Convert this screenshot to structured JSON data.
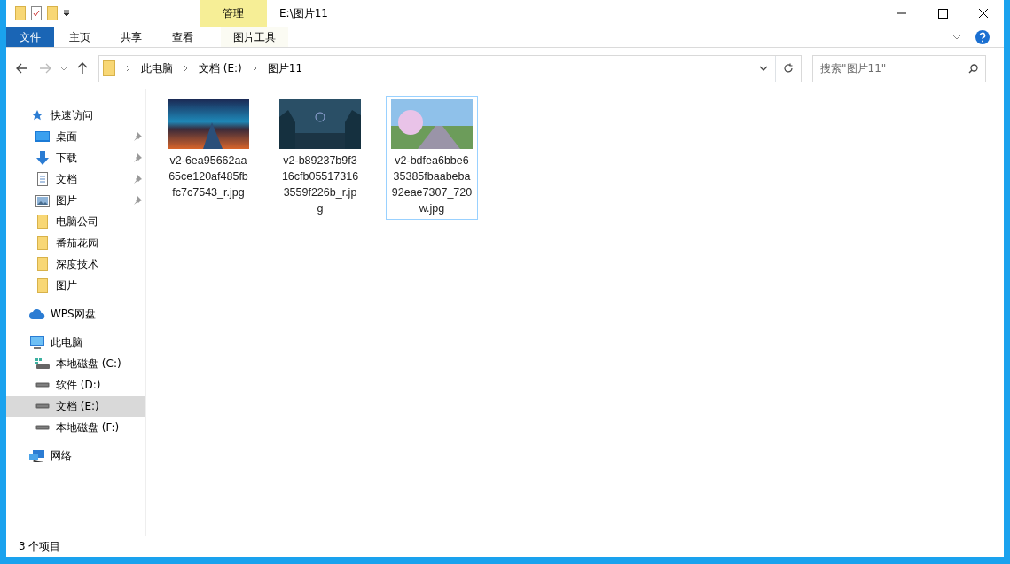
{
  "window": {
    "title": "E:\\图片11"
  },
  "context_tab": {
    "group": "管理",
    "label": "图片工具"
  },
  "ribbon_tabs": [
    {
      "label": "文件",
      "kind": "file"
    },
    {
      "label": "主页",
      "kind": "tab"
    },
    {
      "label": "共享",
      "kind": "tab"
    },
    {
      "label": "查看",
      "kind": "tab"
    }
  ],
  "breadcrumb": [
    "此电脑",
    "文档 (E:)",
    "图片11"
  ],
  "search": {
    "placeholder": "搜索\"图片11\""
  },
  "sidebar": {
    "items": [
      {
        "label": "快速访问",
        "kind": "quick",
        "pinned": false,
        "selected": false,
        "children": [
          {
            "label": "桌面",
            "kind": "desktop",
            "pinned": true,
            "selected": false
          },
          {
            "label": "下载",
            "kind": "download",
            "pinned": true,
            "selected": false
          },
          {
            "label": "文档",
            "kind": "document",
            "pinned": true,
            "selected": false
          },
          {
            "label": "图片",
            "kind": "pictures",
            "pinned": true,
            "selected": false
          },
          {
            "label": "电脑公司",
            "kind": "folder",
            "pinned": false,
            "selected": false
          },
          {
            "label": "番茄花园",
            "kind": "folder",
            "pinned": false,
            "selected": false
          },
          {
            "label": "深度技术",
            "kind": "folder",
            "pinned": false,
            "selected": false
          },
          {
            "label": "图片",
            "kind": "folder",
            "pinned": false,
            "selected": false
          }
        ]
      },
      {
        "label": "WPS网盘",
        "kind": "cloud",
        "pinned": false,
        "selected": false
      },
      {
        "label": "此电脑",
        "kind": "pc",
        "pinned": false,
        "selected": false,
        "children": [
          {
            "label": "本地磁盘 (C:)",
            "kind": "sysdrive",
            "pinned": false,
            "selected": false
          },
          {
            "label": "软件 (D:)",
            "kind": "drive",
            "pinned": false,
            "selected": false
          },
          {
            "label": "文档 (E:)",
            "kind": "drive",
            "pinned": false,
            "selected": true
          },
          {
            "label": "本地磁盘 (F:)",
            "kind": "drive",
            "pinned": false,
            "selected": false
          }
        ]
      },
      {
        "label": "网络",
        "kind": "network",
        "pinned": false,
        "selected": false
      }
    ]
  },
  "files": [
    {
      "name_lines": [
        "v2-6ea95662aa",
        "65ce120af485fb",
        "fc7c7543_r.jpg"
      ],
      "selected": false
    },
    {
      "name_lines": [
        "v2-b89237b9f3",
        "16cfb05517316",
        "3559f226b_r.jp",
        "g"
      ],
      "selected": false
    },
    {
      "name_lines": [
        "v2-bdfea6bbe6",
        "35385fbaabeba",
        "92eae7307_720",
        "w.jpg"
      ],
      "selected": true
    }
  ],
  "status_bar": "3 个项目"
}
